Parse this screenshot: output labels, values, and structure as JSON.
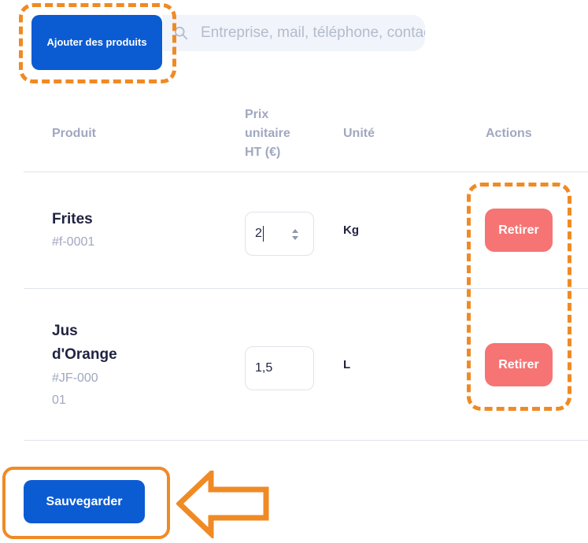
{
  "toolbar": {
    "add_products_label": "Ajouter des produits",
    "search_placeholder": "Entreprise, mail, téléphone, contact"
  },
  "table": {
    "headers": {
      "product": "Produit",
      "unit_price": "Prix unitaire HT (€)",
      "unit": "Unité",
      "actions": "Actions"
    },
    "rows": [
      {
        "name": "Frites",
        "code": "#f-0001",
        "price": "2",
        "unit": "Kg",
        "remove_label": "Retirer"
      },
      {
        "name": "Jus d'Orange",
        "code": "#JF-00001",
        "price": "1,5",
        "unit": "L",
        "remove_label": "Retirer"
      }
    ]
  },
  "footer": {
    "save_label": "Sauvegarder"
  },
  "colors": {
    "primary": "#0b5bd3",
    "danger": "#f67474",
    "highlight": "#f08a24"
  },
  "icons": {
    "search": "search-icon",
    "spinner": "spinner-icon",
    "arrow": "arrow-left-annotation"
  }
}
